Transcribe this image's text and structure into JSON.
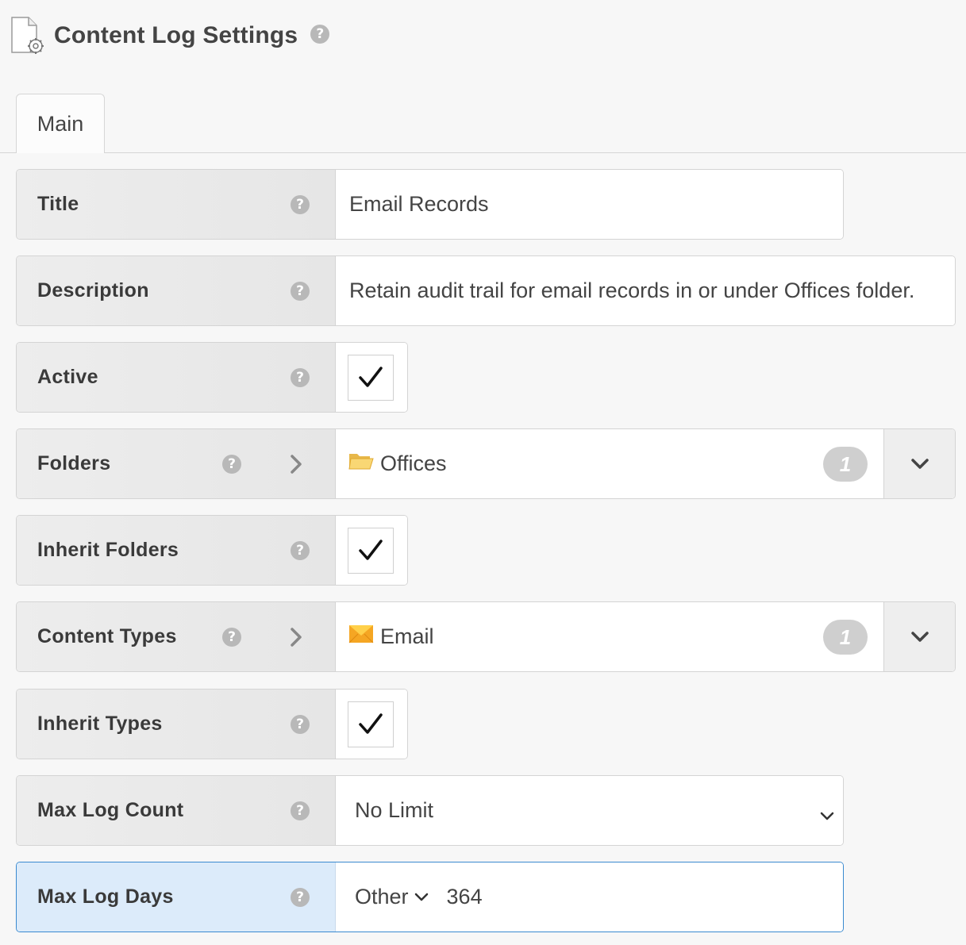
{
  "page": {
    "title": "Content Log Settings"
  },
  "tabs": [
    {
      "label": "Main"
    }
  ],
  "fields": {
    "title": {
      "label": "Title",
      "value": "Email Records"
    },
    "description": {
      "label": "Description",
      "value": "Retain audit trail for email records in or under Offices folder."
    },
    "active": {
      "label": "Active",
      "checked": true
    },
    "folders": {
      "label": "Folders",
      "value": "Offices",
      "count": "1",
      "icon": "folder-icon"
    },
    "inherit_folders": {
      "label": "Inherit Folders",
      "checked": true
    },
    "content_types": {
      "label": "Content Types",
      "value": "Email",
      "count": "1",
      "icon": "email-icon"
    },
    "inherit_types": {
      "label": "Inherit Types",
      "checked": true
    },
    "max_log_count": {
      "label": "Max Log Count",
      "value": "No Limit"
    },
    "max_log_days": {
      "label": "Max Log Days",
      "unit": "Other",
      "value": "364"
    }
  },
  "colors": {
    "accent": "#3a8ad0",
    "active_row_bg": "#dcebfa",
    "badge": "#cfcfcf",
    "help": "#b8b8b8"
  }
}
